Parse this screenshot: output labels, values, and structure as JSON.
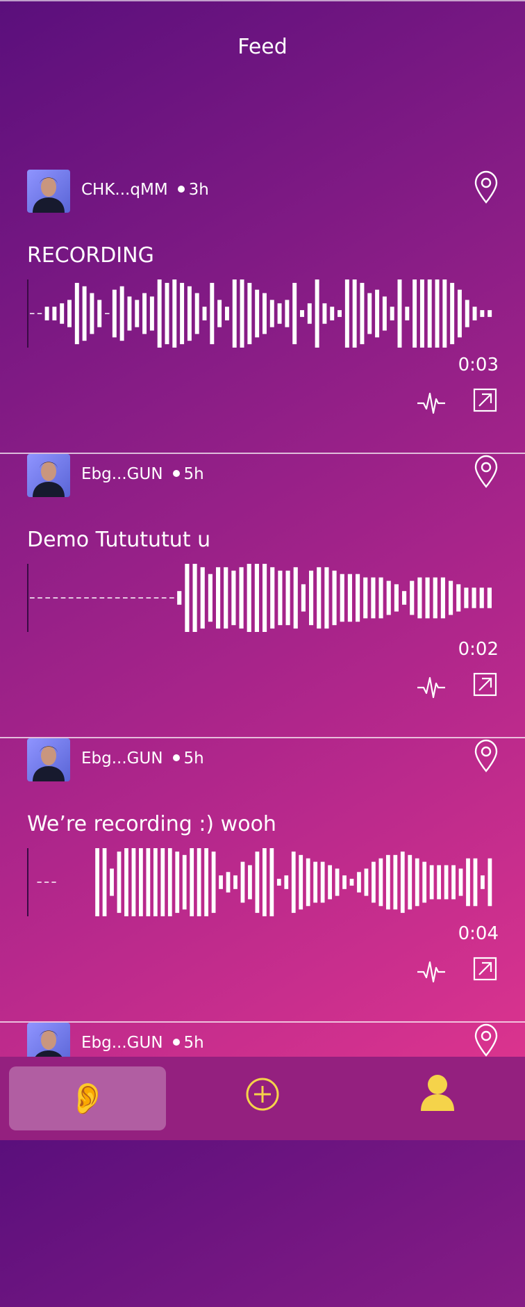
{
  "header": {
    "title": "Feed"
  },
  "posts": [
    {
      "user": "CHK...qMM",
      "age": "3h",
      "title": "RECORDING",
      "duration": "0:03",
      "played_fraction": 0,
      "wave": [
        1,
        1,
        2,
        2,
        3,
        4,
        9,
        8,
        6,
        4,
        1,
        7,
        8,
        5,
        4,
        6,
        5,
        10,
        9,
        10,
        9,
        8,
        6,
        2,
        9,
        4,
        2,
        10,
        10,
        9,
        7,
        6,
        4,
        3,
        4,
        9,
        1,
        3,
        10,
        3,
        2,
        1,
        10,
        10,
        9,
        6,
        7,
        5,
        2,
        10,
        2,
        10,
        10,
        10,
        10,
        10,
        9,
        7,
        4,
        2,
        1,
        1
      ]
    },
    {
      "user": "Ebg...GUN",
      "age": "5h",
      "title": "Demo Tutututut u",
      "duration": "0:02",
      "played_fraction": 0,
      "wave": [
        1,
        1,
        1,
        1,
        1,
        1,
        1,
        1,
        1,
        1,
        1,
        1,
        1,
        1,
        1,
        1,
        1,
        1,
        1,
        2,
        10,
        10,
        9,
        7,
        9,
        9,
        8,
        9,
        10,
        10,
        10,
        9,
        8,
        8,
        9,
        4,
        8,
        9,
        9,
        8,
        7,
        7,
        7,
        6,
        6,
        6,
        5,
        4,
        2,
        5,
        6,
        6,
        6,
        6,
        5,
        4,
        3,
        3,
        3,
        3
      ]
    },
    {
      "user": "Ebg...GUN",
      "age": "5h",
      "title": "We’re recording :) wooh",
      "duration": "0:04",
      "played_fraction": 0,
      "wave": [
        0,
        1,
        1,
        1,
        0,
        0,
        0,
        0,
        0,
        10,
        10,
        4,
        9,
        10,
        10,
        10,
        10,
        10,
        10,
        10,
        9,
        8,
        10,
        10,
        10,
        9,
        2,
        3,
        2,
        6,
        5,
        9,
        10,
        10,
        1,
        2,
        9,
        8,
        7,
        6,
        6,
        5,
        4,
        2,
        1,
        3,
        4,
        6,
        7,
        8,
        8,
        9,
        8,
        7,
        6,
        5,
        5,
        5,
        5,
        4,
        7,
        7,
        2,
        7
      ]
    },
    {
      "user": "Ebg...GUN",
      "age": "5h"
    }
  ],
  "nav": {
    "listen_label": "Listen",
    "add_label": "New recording",
    "profile_label": "Profile"
  },
  "colors": {
    "accent": "#f5d34a",
    "line": "#ffffff"
  },
  "icons": {
    "pin": "map-pin-icon",
    "waveform": "waveform-icon",
    "open": "open-external-icon",
    "ear": "ear-icon",
    "add": "add-circle-icon",
    "profile": "person-icon"
  }
}
